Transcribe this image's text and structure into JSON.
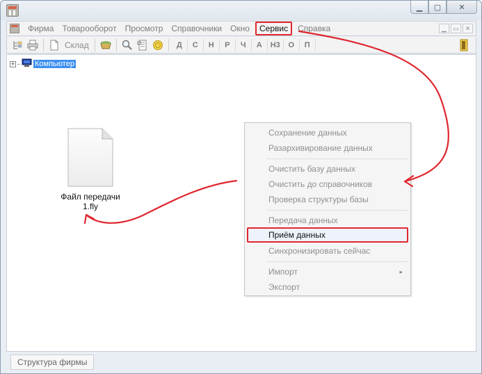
{
  "window": {
    "minimize_glyph": "▁",
    "maximize_glyph": "▢",
    "close_glyph": "✕"
  },
  "menubar": {
    "items": [
      "Фирма",
      "Товарооборот",
      "Просмотр",
      "Справочники",
      "Окно",
      "Сервис",
      "Справка"
    ],
    "active_index": 5,
    "mdi_controls": [
      "▁",
      "▭",
      "✕"
    ]
  },
  "toolbar": {
    "warehouse_label": "Склад",
    "letters": [
      "Д",
      "С",
      "Н",
      "Р",
      "Ч",
      "А",
      "Н3",
      "О",
      "П"
    ],
    "icons": [
      "tree-icon",
      "print-icon",
      "new-document-icon",
      "basket-icon",
      "search-icon",
      "report-icon",
      "coin-icon",
      "exit-icon"
    ]
  },
  "tree": {
    "expander": "+",
    "root_label": "Компьютер"
  },
  "file": {
    "line1": "Файл передачи",
    "line2": "1.fly"
  },
  "context_menu": {
    "items": [
      "Сохранение данных",
      "Разархивирование данных",
      "Очистить базу данных",
      "Очистить до справочников",
      "Проверка структуры базы",
      "Передача данных",
      "Приём данных",
      "Синхронизировать сейчас",
      "Импорт",
      "Экспорт"
    ],
    "active_label": "Приём данных",
    "submenu_arrow": "▸"
  },
  "status": {
    "tab_label": "Структура фирмы"
  },
  "colors": {
    "highlight": "#e0262f",
    "selection": "#3c8ff0"
  }
}
